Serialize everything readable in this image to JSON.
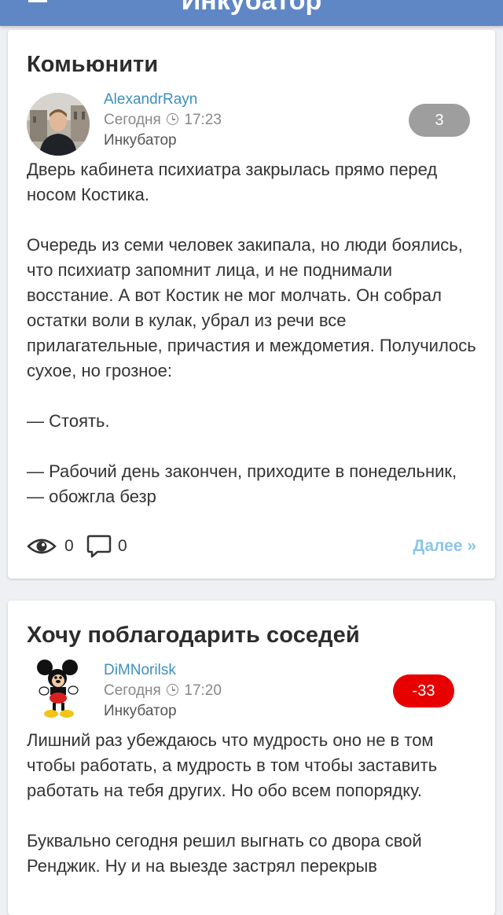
{
  "app": {
    "title": "Инкубатор"
  },
  "posts": [
    {
      "title": "Комьюнити",
      "author": "AlexandrRayn",
      "date": "Сегодня",
      "time": "17:23",
      "community": "Инкубатор",
      "rating": "3",
      "rating_color": "#9e9e9e",
      "paragraphs": [
        "Дверь кабинета психиатра закрылась прямо перед носом Костика.",
        "Очередь из семи человек закипала, но люди боялись, что психиатр запомнит лица, и не поднимали восстание. А вот Костик не мог молчать. Он собрал остатки воли в кулак, убрал из речи все прилагательные, причастия и междометия. Получилось сухое, но грозное:",
        "— Стоять.",
        "— Рабочий день закончен, приходите в понедельник, — обожгла безр"
      ],
      "views": "0",
      "comments": "0",
      "more_label": "Далее »"
    },
    {
      "title": "Хочу поблагодарить соседей",
      "author": "DiMNorilsk",
      "date": "Сегодня",
      "time": "17:20",
      "community": "Инкубатор",
      "rating": "-33",
      "rating_color": "#e80000",
      "paragraphs": [
        "Лишний раз убеждаюсь что мудрость оно не в том чтобы работать, а мудрость в том чтобы заставить работать на тебя других. Но обо всем попорядку.",
        "Буквально сегодня решил выгнать со двора свой Ренджик. Ну и на выезде застрял перекрыв"
      ]
    }
  ]
}
